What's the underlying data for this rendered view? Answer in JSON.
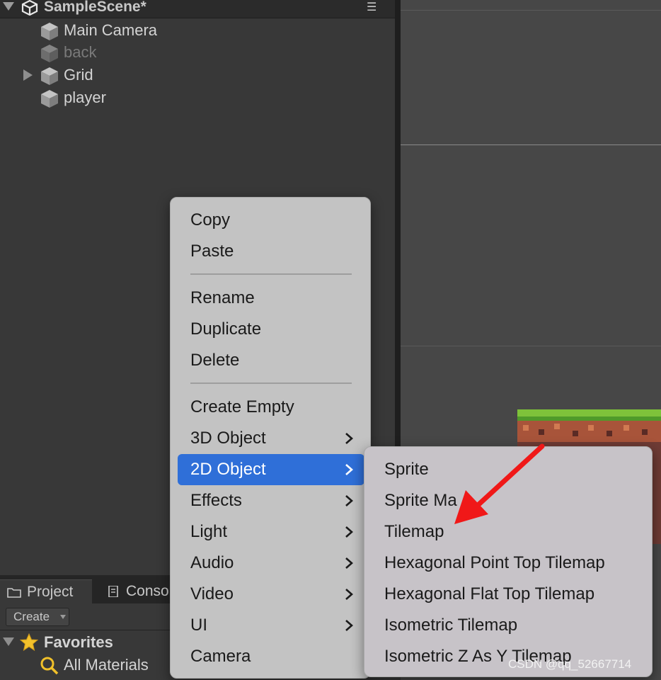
{
  "hierarchy": {
    "scene_title": "SampleScene*",
    "menu_icon": "☰",
    "items": [
      {
        "label": "Main Camera",
        "icon": "cube-icon"
      },
      {
        "label": "back",
        "icon": "cube-icon",
        "disabled": true
      },
      {
        "label": "Grid",
        "icon": "cube-icon",
        "expandable": true
      },
      {
        "label": "player",
        "icon": "cube-icon"
      }
    ]
  },
  "project": {
    "tabs": [
      {
        "label": "Project",
        "icon": "folder-icon"
      },
      {
        "label": "Conso",
        "icon": "console-icon"
      }
    ],
    "create_label": "Create",
    "favorites_label": "Favorites",
    "all_materials_label": "All Materials"
  },
  "context_menu": {
    "items": [
      {
        "label": "Copy"
      },
      {
        "label": "Paste"
      },
      {
        "label": "Rename"
      },
      {
        "label": "Duplicate"
      },
      {
        "label": "Delete"
      },
      {
        "label": "Create Empty"
      },
      {
        "label": "3D Object",
        "submenu": true
      },
      {
        "label": "2D Object",
        "submenu": true,
        "active": true
      },
      {
        "label": "Effects",
        "submenu": true
      },
      {
        "label": "Light",
        "submenu": true
      },
      {
        "label": "Audio",
        "submenu": true
      },
      {
        "label": "Video",
        "submenu": true
      },
      {
        "label": "UI",
        "submenu": true
      },
      {
        "label": "Camera"
      }
    ]
  },
  "submenu_2d": {
    "items": [
      {
        "label": "Sprite"
      },
      {
        "label": "Sprite Ma"
      },
      {
        "label": "Tilemap"
      },
      {
        "label": "Hexagonal Point Top Tilemap"
      },
      {
        "label": "Hexagonal Flat Top Tilemap"
      },
      {
        "label": "Isometric Tilemap"
      },
      {
        "label": "Isometric Z As Y Tilemap"
      }
    ]
  },
  "watermark": "CSDN @qq_52667714",
  "colors": {
    "menu_bg": "#c3c3c3",
    "highlight": "#2f6fd8",
    "annotation_arrow": "#f01818",
    "panel_bg": "#383838",
    "scene_bg": "#474747"
  }
}
